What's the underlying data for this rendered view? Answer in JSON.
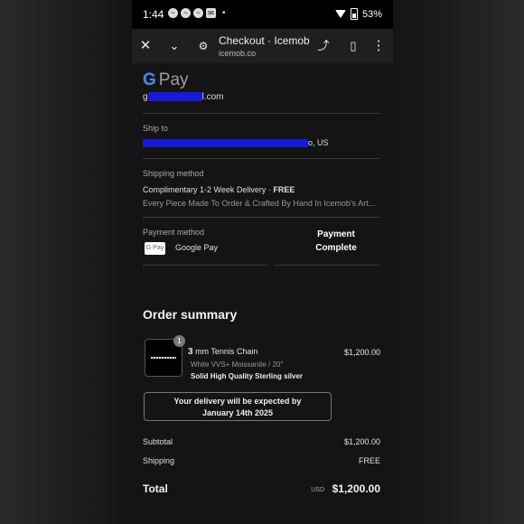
{
  "status_bar": {
    "time": "1:44",
    "battery": "53%"
  },
  "toolbar": {
    "title": "Checkout · Icemob",
    "url": "icemob.co"
  },
  "gpay": {
    "logo_g": "G",
    "logo_pay": "Pay",
    "email_prefix": "g",
    "email_suffix": "l.com"
  },
  "ship_to": {
    "label": "Ship to",
    "prefix": "",
    "suffix": "o, US"
  },
  "shipping_method": {
    "label": "Shipping method",
    "name": "Complimentary 1-2 Week Delivery · ",
    "price": "FREE",
    "description": "Every Piece Made To Order & Crafted By Hand In Icemob's Art..."
  },
  "payment": {
    "label": "Payment method",
    "chip": "G Pay",
    "name": "Google Pay",
    "overlay_line1": "Payment",
    "overlay_line2": "Complete"
  },
  "order_summary": {
    "title": "Order summary",
    "item": {
      "quantity": "1",
      "name_bold": "3",
      "name_rest": " mm Tennis Chain",
      "price": "$1,200.00",
      "variant": "White VVS+ Moissanite / 20\"",
      "material": "Solid High Quality Sterling silver"
    },
    "delivery_line1": "Your delivery will be expected by",
    "delivery_line2": "January 14th 2025",
    "subtotal_label": "Subtotal",
    "subtotal_value": "$1,200.00",
    "shipping_label": "Shipping",
    "shipping_value": "FREE",
    "total_label": "Total",
    "total_currency": "USD",
    "total_value": "$1,200.00"
  }
}
